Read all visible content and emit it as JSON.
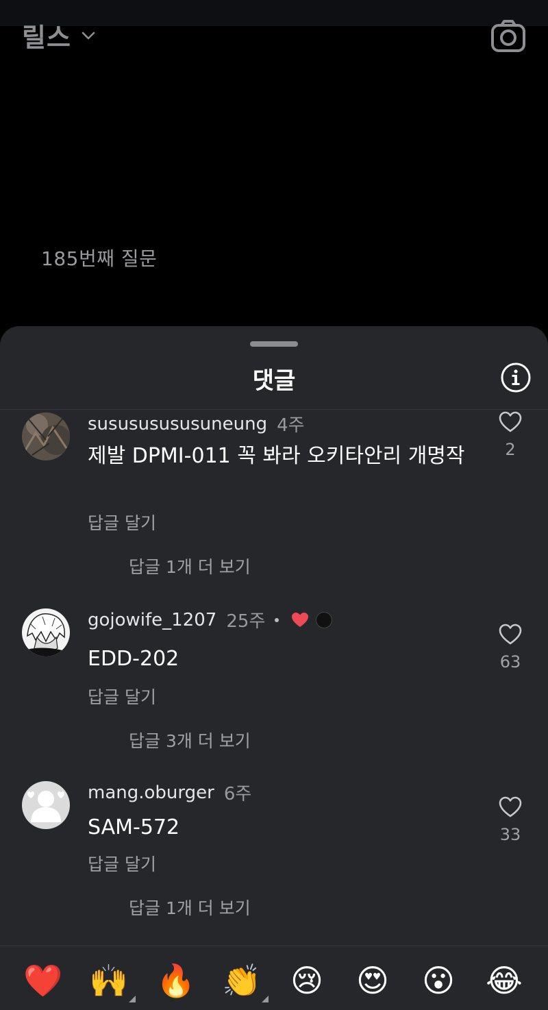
{
  "header": {
    "title": "릴스"
  },
  "reel": {
    "caption": "185번째 질문"
  },
  "comments_sheet": {
    "title": "댓글",
    "comments": [
      {
        "username": "susususususuneung",
        "time": "4주",
        "text": "제발 DPMI-011 꼭 봐라 오키타안리 개명작",
        "reply_label": "답글 달기",
        "more_replies": "답글 1개 더 보기",
        "likes": "2"
      },
      {
        "username": "gojowife_1207",
        "time": "25주",
        "text": "EDD-202",
        "reply_label": "답글 달기",
        "more_replies": "답글 3개 더 보기",
        "likes": "63"
      },
      {
        "username": "mang.oburger",
        "time": "6주",
        "text": "SAM-572",
        "reply_label": "답글 달기",
        "more_replies": "답글 1개 더 보기",
        "likes": "33"
      }
    ]
  },
  "emoji_bar": {
    "emojis": [
      "❤️",
      "🙌",
      "🔥",
      "👏",
      "😢",
      "😍",
      "😮",
      "😂"
    ]
  },
  "colors": {
    "background": "#000000",
    "sheet": "#25272b",
    "accent_heart": "#ed4956"
  }
}
